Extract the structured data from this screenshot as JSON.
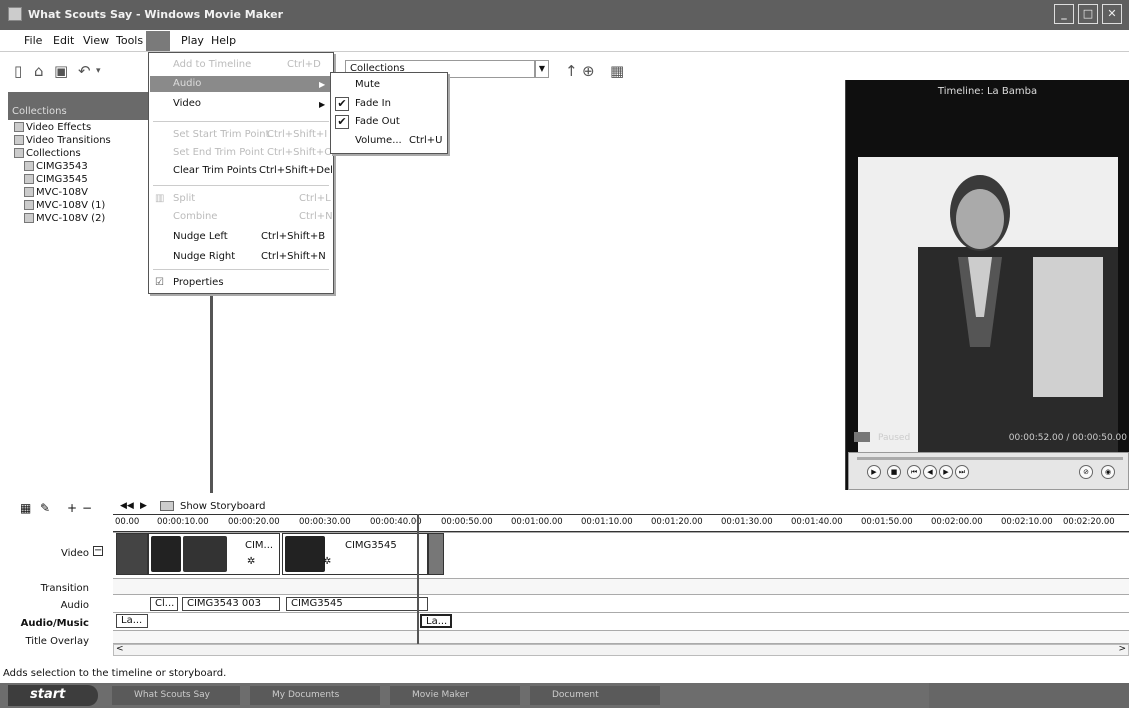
{
  "window": {
    "title": "What Scouts Say - Windows Movie Maker"
  },
  "menubar": {
    "items": [
      "File",
      "Edit",
      "View",
      "Tools",
      "Play",
      "Help"
    ]
  },
  "toolbar": {
    "collections_value": "Collections"
  },
  "left_pane": {
    "header": "Collections",
    "items": [
      "Video Effects",
      "Video Transitions",
      "Collections"
    ],
    "collections": [
      "CIMG3543",
      "CIMG3545",
      "MVC-108V",
      "MVC-108V (1)",
      "MVC-108V (2)"
    ]
  },
  "clip_menu": {
    "items": [
      {
        "label": "Add to Timeline",
        "shortcut": "Ctrl+D",
        "disabled": true
      },
      {
        "label": "Audio",
        "shortcut": "",
        "disabled": true,
        "submenu": true
      },
      {
        "label": "Video",
        "shortcut": "",
        "disabled": false,
        "submenu": true
      },
      {
        "label": "Set Start Trim Point",
        "shortcut": "Ctrl+Shift+I",
        "disabled": true
      },
      {
        "label": "Set End Trim Point",
        "shortcut": "Ctrl+Shift+O",
        "disabled": true
      },
      {
        "label": "Clear Trim Points",
        "shortcut": "Ctrl+Shift+Del",
        "disabled": false
      },
      {
        "label": "Split",
        "shortcut": "Ctrl+L",
        "disabled": true
      },
      {
        "label": "Combine",
        "shortcut": "Ctrl+N",
        "disabled": true
      },
      {
        "label": "Nudge Left",
        "shortcut": "Ctrl+Shift+B",
        "disabled": false
      },
      {
        "label": "Nudge Right",
        "shortcut": "Ctrl+Shift+N",
        "disabled": false
      },
      {
        "label": "Properties",
        "shortcut": "",
        "disabled": false
      }
    ]
  },
  "audio_submenu": {
    "items": [
      {
        "label": "Mute",
        "shortcut": "",
        "checked": false
      },
      {
        "label": "Fade In",
        "shortcut": "",
        "checked": true
      },
      {
        "label": "Fade Out",
        "shortcut": "",
        "checked": true
      },
      {
        "label": "Volume...",
        "shortcut": "Ctrl+U",
        "checked": false
      }
    ]
  },
  "monitor": {
    "title": "Timeline: La Bamba",
    "status": "Paused",
    "time": "00:00:52.00 / 00:00:50.00"
  },
  "timeline": {
    "show_storyboard": "Show Storyboard",
    "ruler": [
      "00.00",
      "00:00:10.00",
      "00:00:20.00",
      "00:00:30.00",
      "00:00:40.00",
      "00:00:50.00",
      "00:01:00.00",
      "00:01:10.00",
      "00:01:20.00",
      "00:01:30.00",
      "00:01:40.00",
      "00:01:50.00",
      "00:02:00.00",
      "00:02:10.00",
      "00:02:20.00"
    ],
    "tracks": [
      "Video",
      "Transition",
      "Audio",
      "Audio/Music",
      "Title Overlay"
    ],
    "video_clips": [
      "CIM...",
      "CIMG3545"
    ],
    "audio_clips": [
      "Cl...",
      "CIMG3543 003",
      "CIMG3545"
    ],
    "music_clips": [
      "La...",
      "La..."
    ]
  },
  "statusbar": {
    "text": "Adds selection to the timeline or storyboard."
  },
  "taskbar": {
    "start": "start",
    "tasks": [
      "What Scouts Say",
      "My Documents",
      "Movie Maker",
      "Document"
    ]
  }
}
